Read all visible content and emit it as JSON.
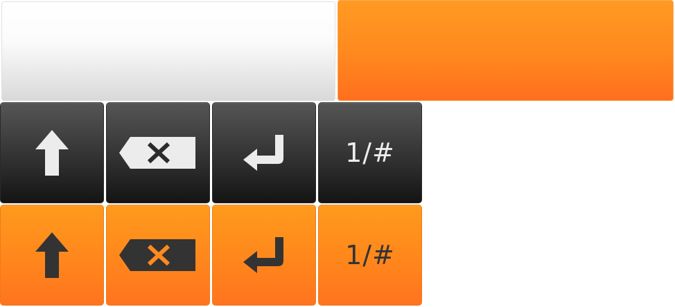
{
  "bars": {
    "white_bar_color": "#f5f5f5",
    "orange_bar_color": "#ff8a1e"
  },
  "keyboard": {
    "rows": [
      {
        "theme": "dark",
        "background": "#2e2e2e",
        "glyph_color": "#ececec",
        "keys": [
          {
            "icon": "shift-arrow-icon"
          },
          {
            "icon": "backspace-icon"
          },
          {
            "icon": "enter-arrow-icon"
          },
          {
            "label": "1/#"
          }
        ]
      },
      {
        "theme": "orange",
        "background": "#ff851d",
        "glyph_color": "#333333",
        "keys": [
          {
            "icon": "shift-arrow-icon"
          },
          {
            "icon": "backspace-icon"
          },
          {
            "icon": "enter-arrow-icon"
          },
          {
            "label": "1/#"
          }
        ]
      }
    ]
  }
}
